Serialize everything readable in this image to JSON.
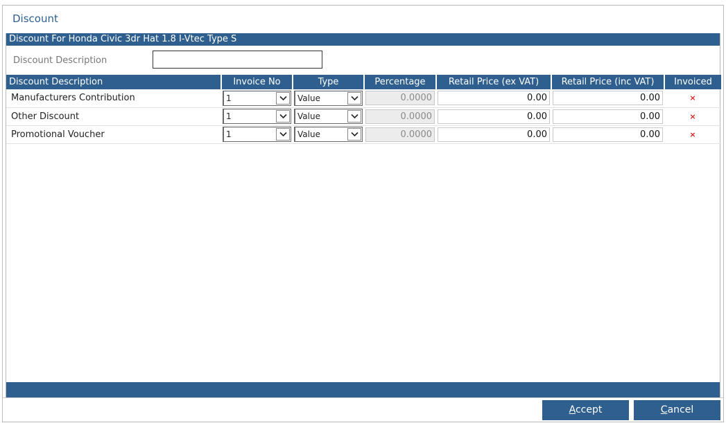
{
  "dialog": {
    "title": "Discount",
    "section_title": "Discount For Honda Civic 3dr Hat 1.8 I-Vtec Type S",
    "description_label": "Discount Description",
    "description_value": ""
  },
  "table": {
    "columns": [
      "Discount Description",
      "Invoice No",
      "Type",
      "Percentage",
      "Retail Price (ex VAT)",
      "Retail Price (inc VAT)",
      "Invoiced"
    ],
    "rows": [
      {
        "description": "Manufacturers Contribution",
        "invoice_no": "1",
        "type": "Value",
        "percentage": "0.0000",
        "retail_ex_vat": "0.00",
        "retail_inc_vat": "0.00",
        "invoiced": "×"
      },
      {
        "description": "Other Discount",
        "invoice_no": "1",
        "type": "Value",
        "percentage": "0.0000",
        "retail_ex_vat": "0.00",
        "retail_inc_vat": "0.00",
        "invoiced": "×"
      },
      {
        "description": "Promotional Voucher",
        "invoice_no": "1",
        "type": "Value",
        "percentage": "0.0000",
        "retail_ex_vat": "0.00",
        "retail_inc_vat": "0.00",
        "invoiced": "×"
      }
    ]
  },
  "buttons": {
    "accept_first": "A",
    "accept_rest": "ccept",
    "cancel_first": "C",
    "cancel_rest": "ancel"
  },
  "colors": {
    "header_bg": "#2e5f8e",
    "title_text": "#2f5f8f",
    "invoiced_x": "#e02020"
  },
  "icons": {
    "dropdown": "chevron-down-icon",
    "not_invoiced": "close-icon"
  }
}
